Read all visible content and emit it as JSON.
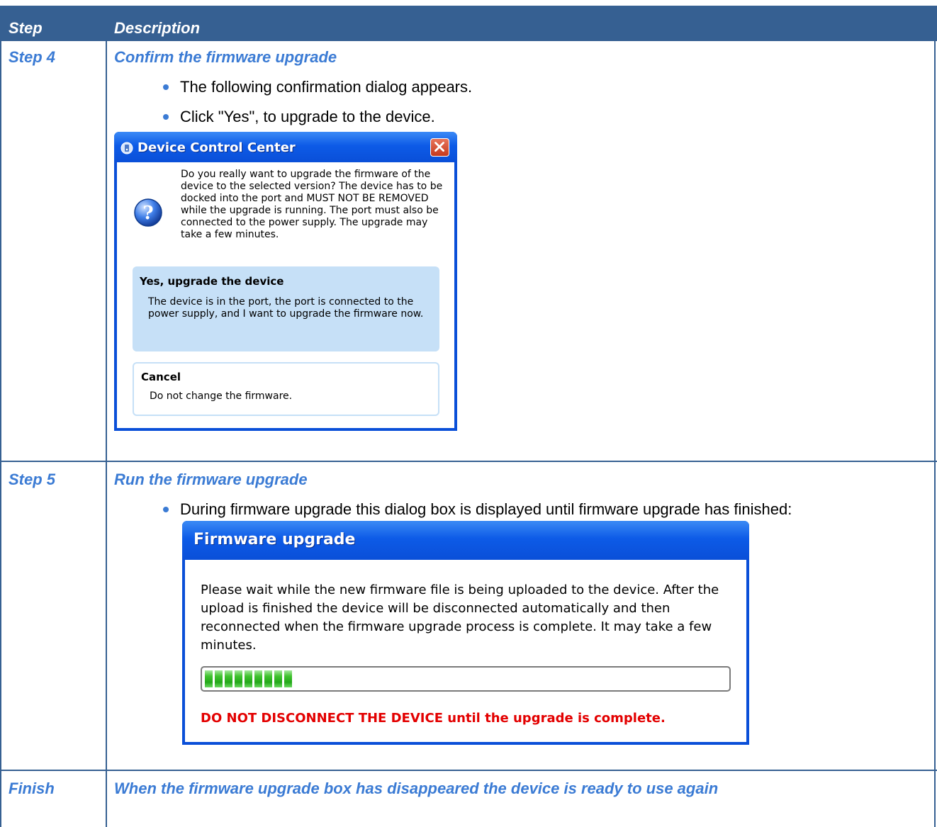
{
  "table": {
    "header": {
      "step": "Step",
      "description": "Description"
    },
    "rows": [
      {
        "step": "Step 4",
        "title": "Confirm the firmware upgrade",
        "bullets": [
          "The following confirmation dialog appears.",
          "Click \"Yes\", to upgrade to the device."
        ]
      },
      {
        "step": "Step 5",
        "title": "Run the firmware upgrade",
        "bullets": [
          "During firmware upgrade this dialog box is displayed until firmware upgrade has finished:"
        ]
      },
      {
        "step": "Finish",
        "title": "When the firmware upgrade box has disappeared the device is ready to use again"
      }
    ]
  },
  "confirm_dialog": {
    "title": "Device Control Center",
    "message": "Do you really want to upgrade the firmware of the device to the selected version? The device has to be docked into the port and MUST NOT BE REMOVED while the upgrade is running. The port must also be connected to the power supply. The upgrade may take a few minutes.",
    "option_yes": {
      "title": "Yes, upgrade the device",
      "description": "The device is in the port, the port is connected to the power supply, and I want to upgrade the firmware now."
    },
    "option_cancel": {
      "title": "Cancel",
      "description": "Do not change the firmware."
    },
    "icons": {
      "app": "device-app-icon",
      "question": "question-icon",
      "close": "close-icon"
    }
  },
  "progress_dialog": {
    "title": "Firmware upgrade",
    "message": "Please wait while the new firmware file is being uploaded to the device. After the upload is finished the device will be disconnected automatically and then reconnected when the firmware upgrade process is complete. It may take a few minutes.",
    "progress_fraction": 0.18,
    "warning": "DO NOT DISCONNECT THE DEVICE until the upgrade is complete.",
    "warning_color": "#e30000"
  },
  "colors": {
    "header_bg": "#366092",
    "accent_text": "#3b7bd4",
    "grid": "#366092"
  }
}
